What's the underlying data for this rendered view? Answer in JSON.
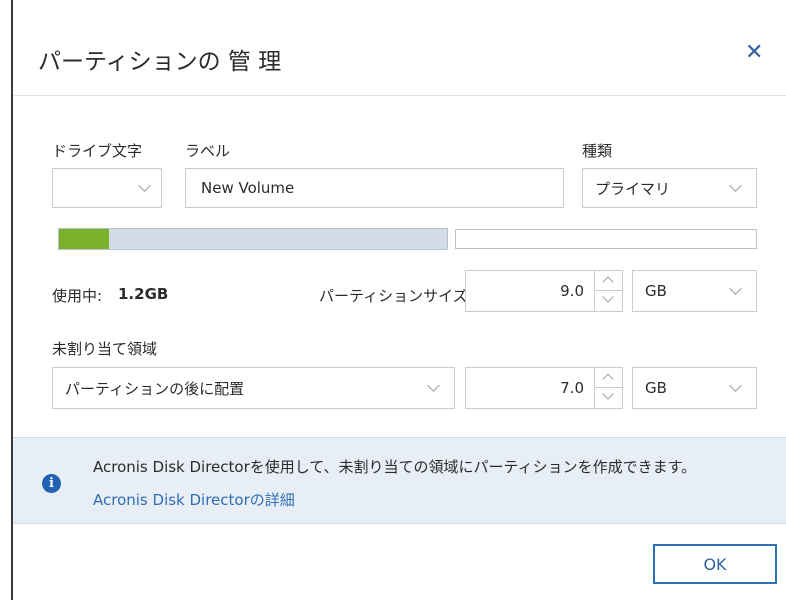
{
  "dialog": {
    "title": "パーティションの 管 理",
    "close_glyph": "✕"
  },
  "drive_letter": {
    "label": "ドライブ文字",
    "value": ""
  },
  "volume_label": {
    "label": "ラベル",
    "value": "New Volume"
  },
  "partition_type": {
    "label": "種類",
    "value": "プライマリ"
  },
  "usage_bar": {
    "used_fraction": 0.13,
    "used_color": "#7ab22e",
    "track_color": "#d3dde7"
  },
  "used": {
    "label": "使用中:",
    "value": "1.2GB"
  },
  "partition_size": {
    "label": "パーティションサイズ:",
    "value": "9.0",
    "unit": "GB"
  },
  "unallocated": {
    "label": "未割り当て領域",
    "placement": "パーティションの後に配置",
    "size": "7.0",
    "unit": "GB"
  },
  "info": {
    "icon": "info-icon",
    "glyph": "i",
    "text": "Acronis Disk Directorを使用して、未割り当ての領域にパーティションを作成できます。",
    "link": "Acronis Disk Directorの詳細"
  },
  "footer": {
    "ok_label": "OK"
  },
  "colors": {
    "accent": "#2f6fb3",
    "info_band": "#e8eef5"
  }
}
